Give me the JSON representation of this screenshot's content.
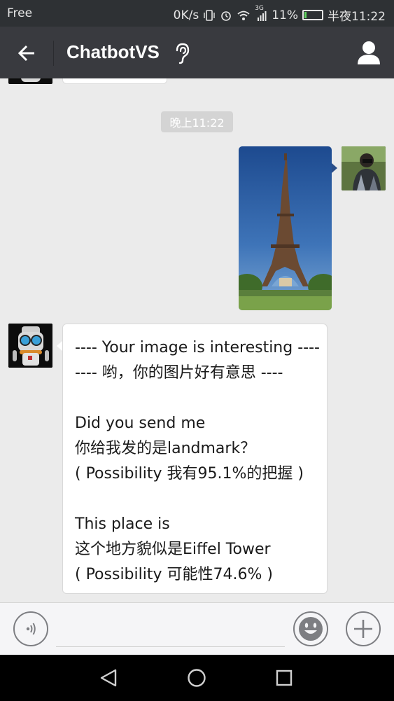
{
  "status_bar": {
    "carrier": "Free",
    "network_speed": "0K/s",
    "network_type": "3G",
    "battery_percent": "11%",
    "battery_level": 0.11,
    "time": "半夜11:22"
  },
  "header": {
    "title": "ChatbotVS",
    "back_icon": "arrow-left-icon",
    "ear_icon": "ear-icon",
    "profile_icon": "person-icon"
  },
  "chat": {
    "timestamp": "晚上11:22",
    "image_message": {
      "subject": "eiffel-tower-photo"
    },
    "bot_reply": {
      "lines": [
        "---- Your image is interesting ----",
        "---- 哟，你的图片好有意思 ----",
        "",
        "Did you send me",
        "你给我发的是landmark？",
        "( Possibility 我有95.1%的把握 )",
        "",
        "This place is",
        "这个地方貌似是Eiffel Tower",
        "( Possibility 可能性74.6% )"
      ]
    }
  },
  "input_bar": {
    "voice_icon": "voice-icon",
    "emoji_icon": "emoji-icon",
    "plus_icon": "plus-icon"
  },
  "colors": {
    "status_bar_bg": "#2e3134",
    "title_bar_bg": "#393a3f",
    "chat_bg": "#ebebeb",
    "bubble_bg": "#ffffff"
  }
}
